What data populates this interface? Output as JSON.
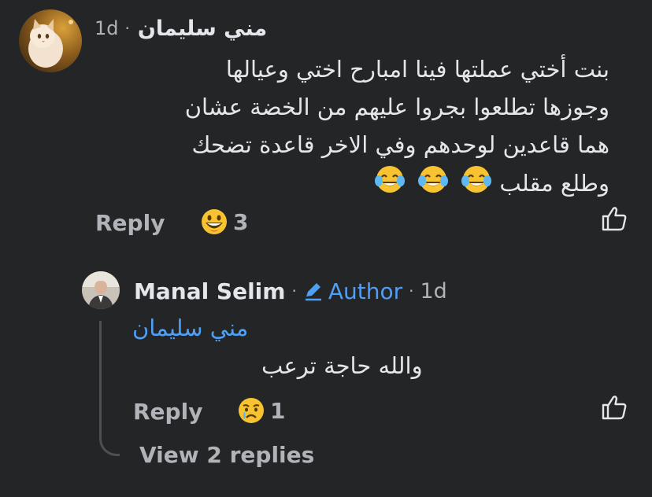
{
  "comment": {
    "author_name": "مني  سليمان",
    "time": "1d",
    "lines": [
      "بنت أختي عملتها فينا امبارح اختي وعيالها",
      "وجوزها تطلعوا بجروا عليهم من الخضة عشان",
      "هما قاعدين لوحدهم وفي الاخر قاعدة تضحك",
      "وطلع مقلب"
    ],
    "reply_label": "Reply",
    "reaction_count": "3",
    "reaction_icon": "grinning-emoji-icon",
    "like_icon": "thumbs-up-icon"
  },
  "reply": {
    "author_name": "Manal Selim",
    "author_badge": "Author",
    "time": "1d",
    "mention": "مني سليمان",
    "text": "والله حاجة ترعب",
    "reply_label": "Reply",
    "reaction_count": "1",
    "reaction_icon": "crying-emoji-icon",
    "like_icon": "thumbs-up-icon"
  },
  "view_replies_label": "View 2 replies",
  "colors": {
    "background": "#242526",
    "text": "#e4e6eb",
    "muted": "#b0b3b8",
    "link": "#4f9ff5"
  }
}
